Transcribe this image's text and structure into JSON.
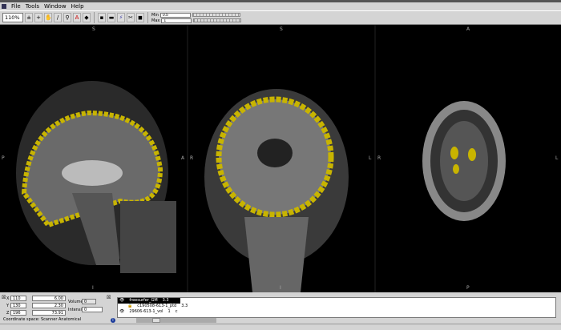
{
  "menu": [
    "File",
    "Tools",
    "Window",
    "Help"
  ],
  "toolbar": {
    "zoom": "110%",
    "min_label": "Min",
    "min_value": "0.5",
    "max_label": "Max",
    "max_value": "1"
  },
  "views": [
    {
      "name": "sagittal",
      "top": "S",
      "bottom": "I",
      "left": "P",
      "right": "A"
    },
    {
      "name": "coronal",
      "top": "S",
      "bottom": "I",
      "left": "R",
      "right": "L"
    },
    {
      "name": "axial",
      "top": "A",
      "bottom": "P",
      "left": "R",
      "right": "L"
    }
  ],
  "coords": {
    "x_label": "X",
    "x": "110",
    "x_val": "6.00",
    "y_label": "Y",
    "y": "130",
    "y_val": "2.30",
    "z_label": "Z",
    "z": "196",
    "z_val": "73.91",
    "volume_label": "Volume",
    "volume": "0",
    "intensity_label": "Intensity",
    "intensity": "0",
    "coord_space": "Coordinate space: Scanner Anatomical"
  },
  "layers": [
    {
      "name": "freesurfer_GM",
      "value": "3.3"
    },
    {
      "name": "c190508-613-1_ptd",
      "value": "3.3"
    },
    {
      "name": "29606-613-1_vol",
      "value": "1",
      "extra": "c"
    }
  ],
  "colors": {
    "overlay": "#c8b400"
  }
}
